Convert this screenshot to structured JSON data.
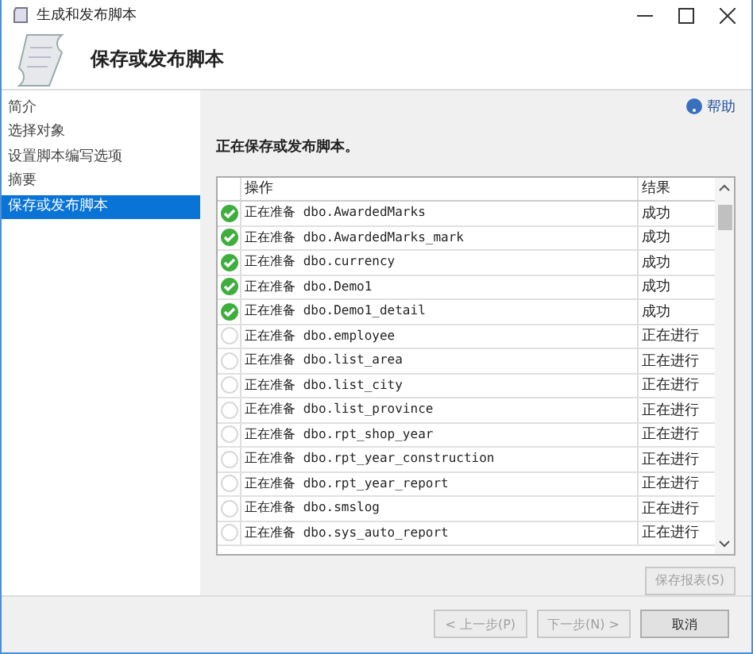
{
  "window": {
    "title": "生成和发布脚本"
  },
  "header": {
    "title": "保存或发布脚本"
  },
  "sidebar": {
    "items": [
      {
        "label": "简介",
        "selected": false
      },
      {
        "label": "选择对象",
        "selected": false
      },
      {
        "label": "设置脚本编写选项",
        "selected": false
      },
      {
        "label": "摘要",
        "selected": false
      },
      {
        "label": "保存或发布脚本",
        "selected": true
      }
    ]
  },
  "help": "帮助",
  "status": "正在保存或发布脚本。",
  "table": {
    "columns": [
      "操作",
      "结果"
    ],
    "rows": [
      {
        "action": "正在准备 dbo.AwardedMarks",
        "result": "成功",
        "done": true
      },
      {
        "action": "正在准备 dbo.AwardedMarks_mark",
        "result": "成功",
        "done": true
      },
      {
        "action": "正在准备 dbo.currency",
        "result": "成功",
        "done": true
      },
      {
        "action": "正在准备 dbo.Demo1",
        "result": "成功",
        "done": true
      },
      {
        "action": "正在准备 dbo.Demo1_detail",
        "result": "成功",
        "done": true
      },
      {
        "action": "正在准备 dbo.employee",
        "result": "正在进行",
        "done": false
      },
      {
        "action": "正在准备 dbo.list_area",
        "result": "正在进行",
        "done": false
      },
      {
        "action": "正在准备 dbo.list_city",
        "result": "正在进行",
        "done": false
      },
      {
        "action": "正在准备 dbo.list_province",
        "result": "正在进行",
        "done": false
      },
      {
        "action": "正在准备 dbo.rpt_shop_year",
        "result": "正在进行",
        "done": false
      },
      {
        "action": "正在准备 dbo.rpt_year_construction",
        "result": "正在进行",
        "done": false
      },
      {
        "action": "正在准备 dbo.rpt_year_report",
        "result": "正在进行",
        "done": false
      },
      {
        "action": "正在准备 dbo.smslog",
        "result": "正在进行",
        "done": false
      },
      {
        "action": "正在准备 dbo.sys_auto_report",
        "result": "正在进行",
        "done": false
      }
    ]
  },
  "save_report": {
    "label": "保存报表(S)",
    "disabled": true
  },
  "buttons": [
    {
      "label": "< 上一步(P)",
      "disabled": true
    },
    {
      "label": "下一步(N) >",
      "disabled": true
    },
    {
      "label": "取消",
      "disabled": false
    }
  ]
}
